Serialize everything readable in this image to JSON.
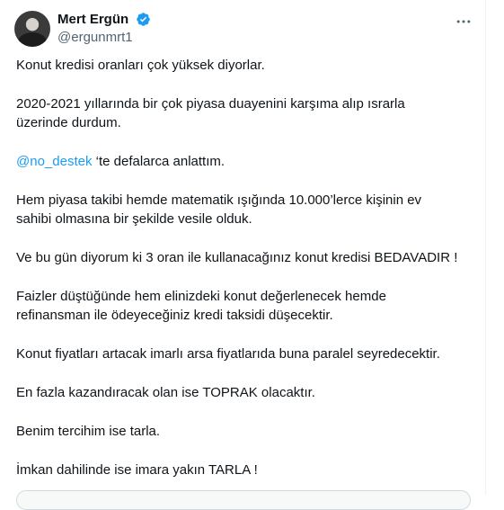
{
  "tweet": {
    "author": {
      "display_name": "Mert Ergün",
      "handle": "@ergunmrt1",
      "verified": true,
      "verified_color": "#1d9bf0"
    },
    "more_icon": "more-horizontal-icon",
    "paragraphs": {
      "p1": "Konut kredisi oranları çok yüksek diyorlar.",
      "p2_line1": "2020-2021 yıllarında bir çok piyasa duayenini karşıma alıp ısrarla",
      "p2_line2": "üzerinde durdum.",
      "p3_mention": "@no_destek",
      "p3_rest": " ‘te defalarca anlattım.",
      "p4_line1": "Hem piyasa takibi hemde matematik ışığında 10.000’lerce kişinin ev",
      "p4_line2": "sahibi olmasına bir şekilde vesile olduk.",
      "p5": "Ve bu gün diyorum ki 3 oran ile kullanacağınız konut kredisi BEDAVADIR !",
      "p6_line1": "Faizler düştüğünde hem elinizdeki konut değerlenecek hemde",
      "p6_line2": "refinansman ile ödeyeceğiniz kredi taksidi düşecektir.",
      "p7": "Konut fiyatları artacak imarlı arsa fiyatlarıda buna paralel seyredecektir.",
      "p8": "En fazla kazandıracak olan ise TOPRAK olacaktır.",
      "p9": "Benim tercihim ise tarla.",
      "p10": "İmkan dahilinde ise imara yakın TARLA !"
    },
    "colors": {
      "link": "#1d9bf0",
      "text": "#0f1419",
      "secondary": "#536471"
    }
  }
}
